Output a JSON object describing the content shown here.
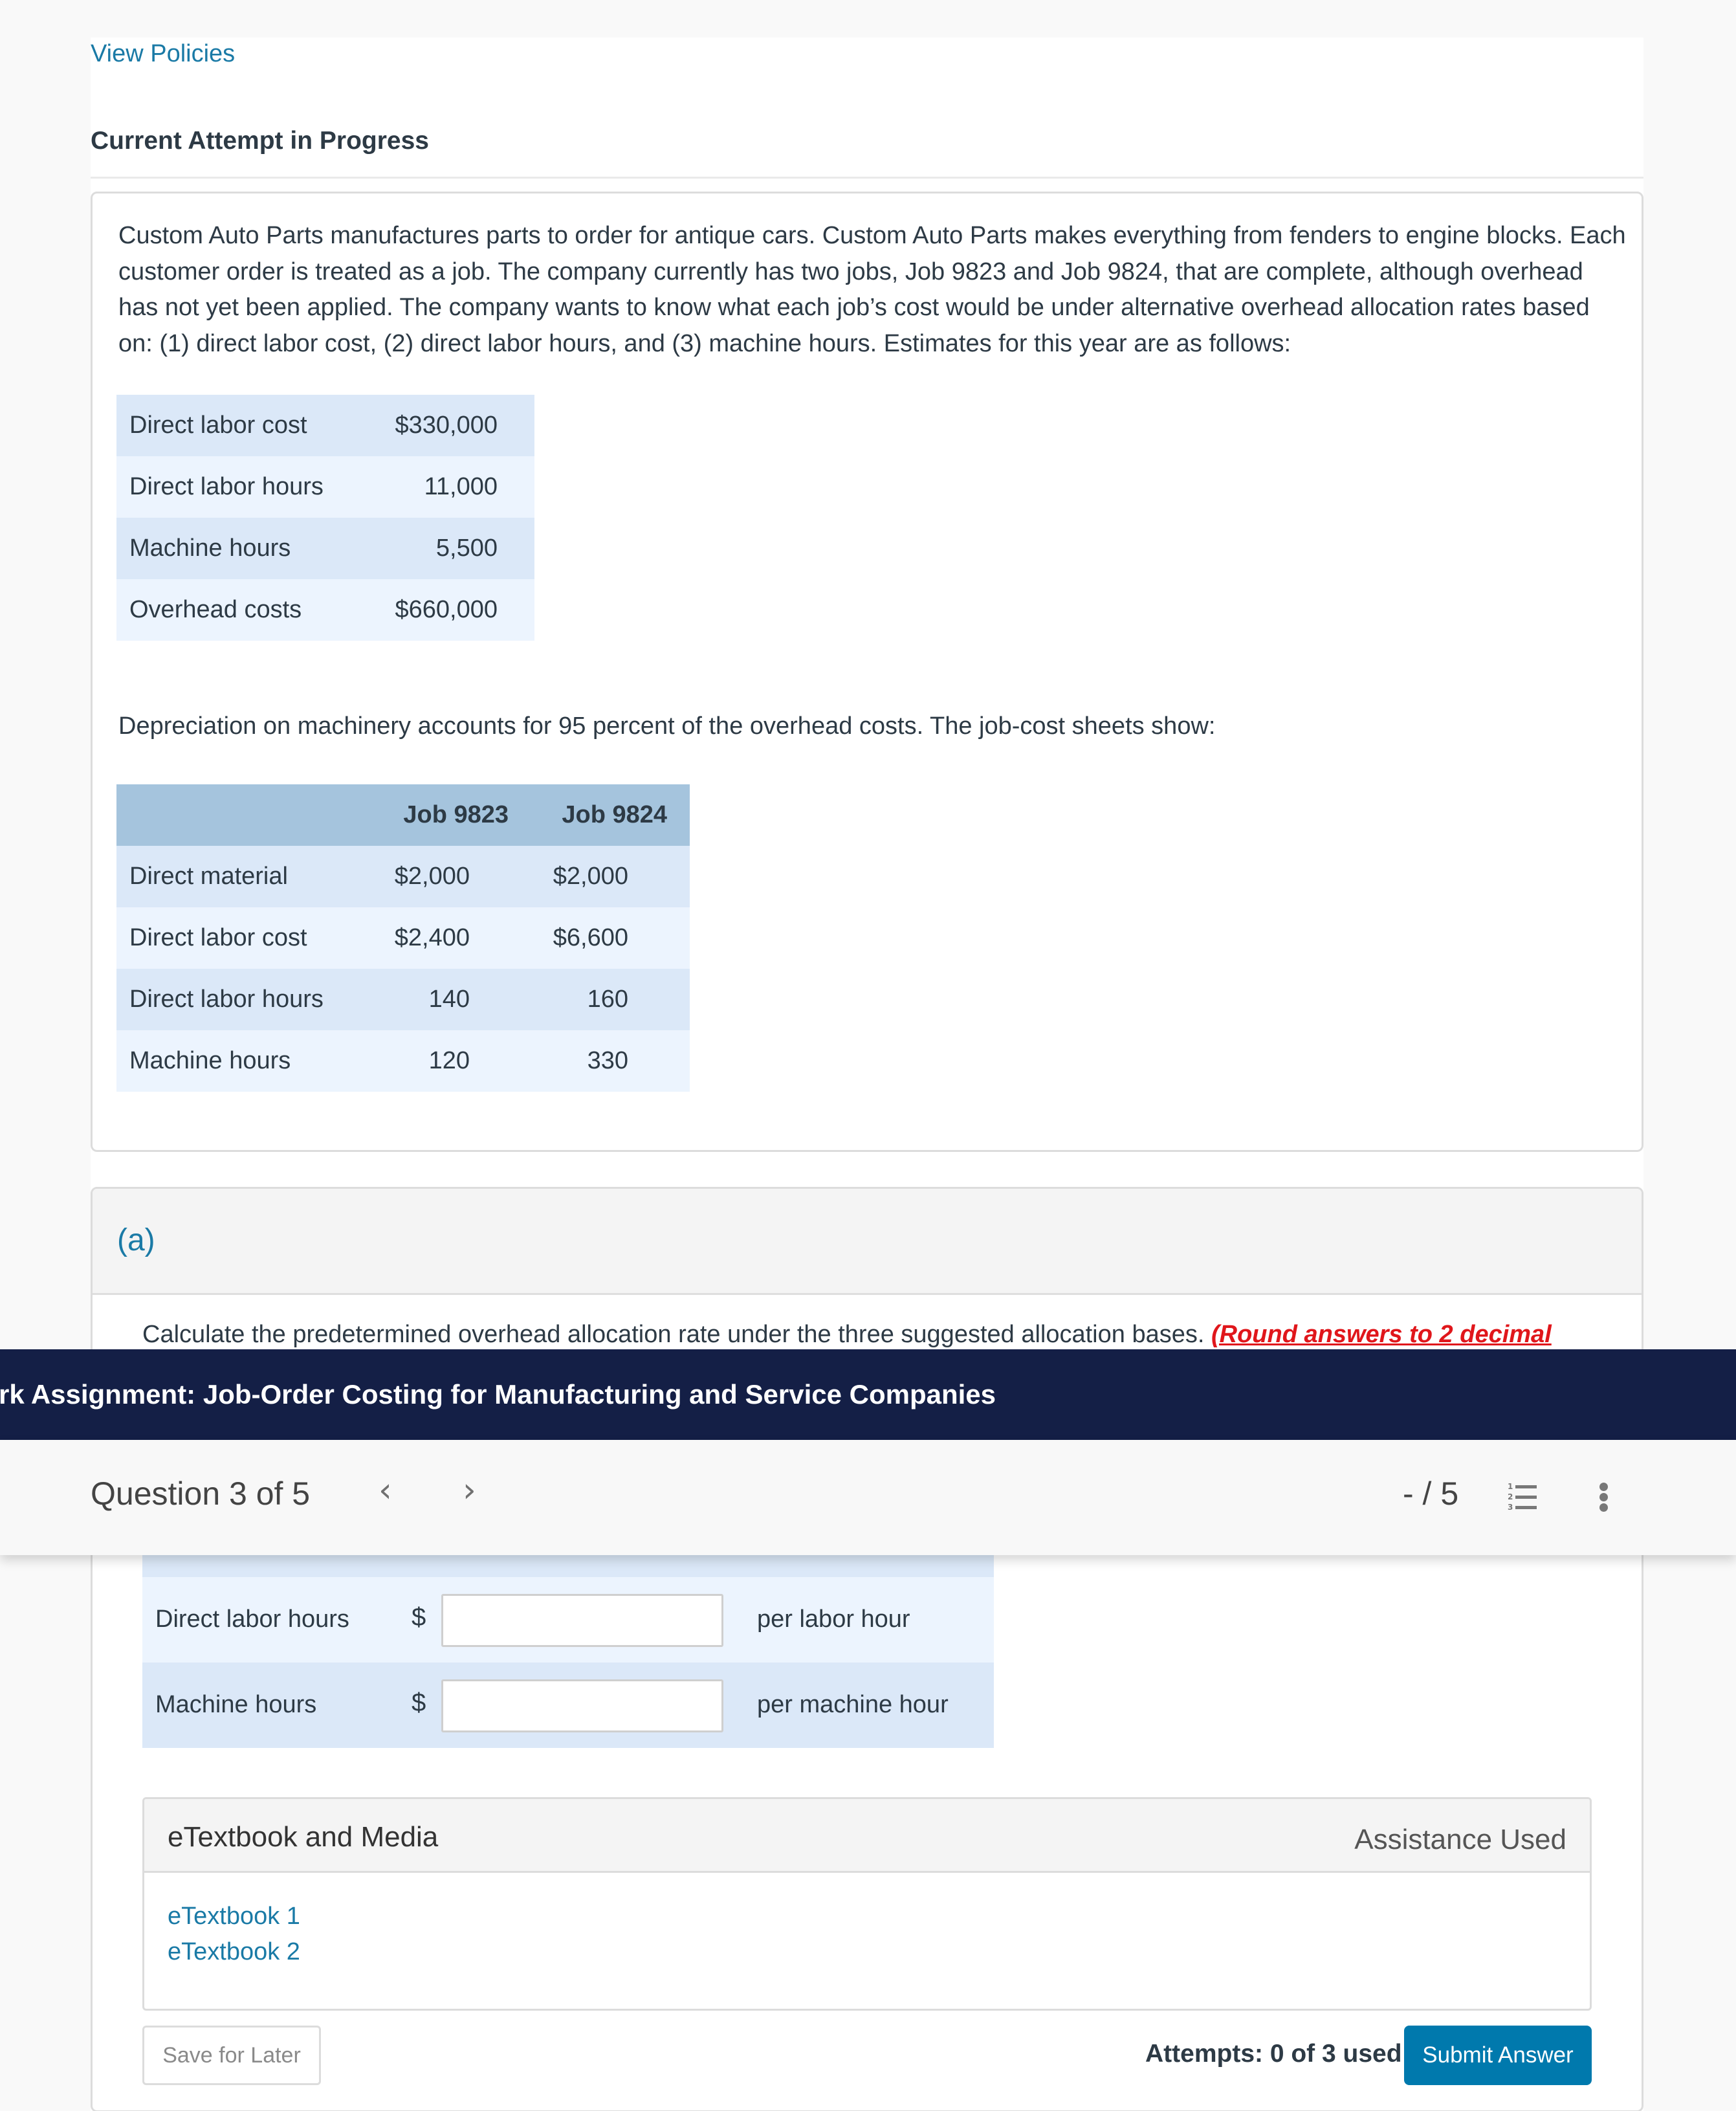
{
  "header": {
    "view_policies": "View Policies",
    "attempt_heading": "Current Attempt in Progress"
  },
  "question": {
    "intro": "Custom Auto Parts manufactures parts to order for antique cars. Custom Auto Parts makes everything from fenders to engine blocks. Each customer order is treated as a job. The company currently has two jobs, Job 9823 and Job 9824, that are complete, although overhead has not yet been applied. The company wants to know what each job’s cost would be under alternative overhead allocation rates based on: (1) direct labor cost, (2) direct labor hours, and (3) machine hours. Estimates for this year are as follows:",
    "estimates": [
      {
        "label": "Direct labor cost",
        "value": "$330,000"
      },
      {
        "label": "Direct labor hours",
        "value": "11,000"
      },
      {
        "label": "Machine hours",
        "value": "5,500"
      },
      {
        "label": "Overhead costs",
        "value": "$660,000"
      }
    ],
    "depreciation_text": "Depreciation on machinery accounts for 95 percent of the overhead costs. The job-cost sheets show:",
    "job_table": {
      "headers": [
        "",
        "Job 9823",
        "Job 9824"
      ],
      "rows": [
        {
          "label": "Direct material",
          "job9823": "$2,000",
          "job9824": "$2,000"
        },
        {
          "label": "Direct labor cost",
          "job9823": "$2,400",
          "job9824": "$6,600"
        },
        {
          "label": "Direct labor hours",
          "job9823": "140",
          "job9824": "160"
        },
        {
          "label": "Machine hours",
          "job9823": "120",
          "job9824": "330"
        }
      ]
    }
  },
  "part_a": {
    "label": "(a)",
    "instruction": "Calculate the predetermined overhead allocation rate under the three suggested allocation bases.",
    "instruction_hint": "(Round answers to 2 decimal",
    "answers": [
      {
        "label": "Direct labor hours",
        "currency": "$",
        "value": "",
        "unit": "per labor hour"
      },
      {
        "label": "Machine hours",
        "currency": "$",
        "value": "",
        "unit": "per machine hour"
      }
    ]
  },
  "media": {
    "title": "eTextbook and Media",
    "assistance": "Assistance Used",
    "links": [
      "eTextbook 1",
      "eTextbook 2"
    ]
  },
  "footer": {
    "save_label": "Save for Later",
    "attempts": "Attempts: 0 of 3 used",
    "submit_label": "Submit Answer"
  },
  "assignment_bar": {
    "title": "rk Assignment: Job-Order Costing for Manufacturing and Service Companies"
  },
  "question_nav": {
    "counter": "Question 3 of 5",
    "prev_icon": "‹",
    "next_icon": "›",
    "score": "- / 5"
  },
  "colors": {
    "link": "#1a7aa6",
    "navy": "#141f46",
    "submit": "#0079ad",
    "hint_red": "#e0161b",
    "table_header": "#a5c4dd"
  }
}
